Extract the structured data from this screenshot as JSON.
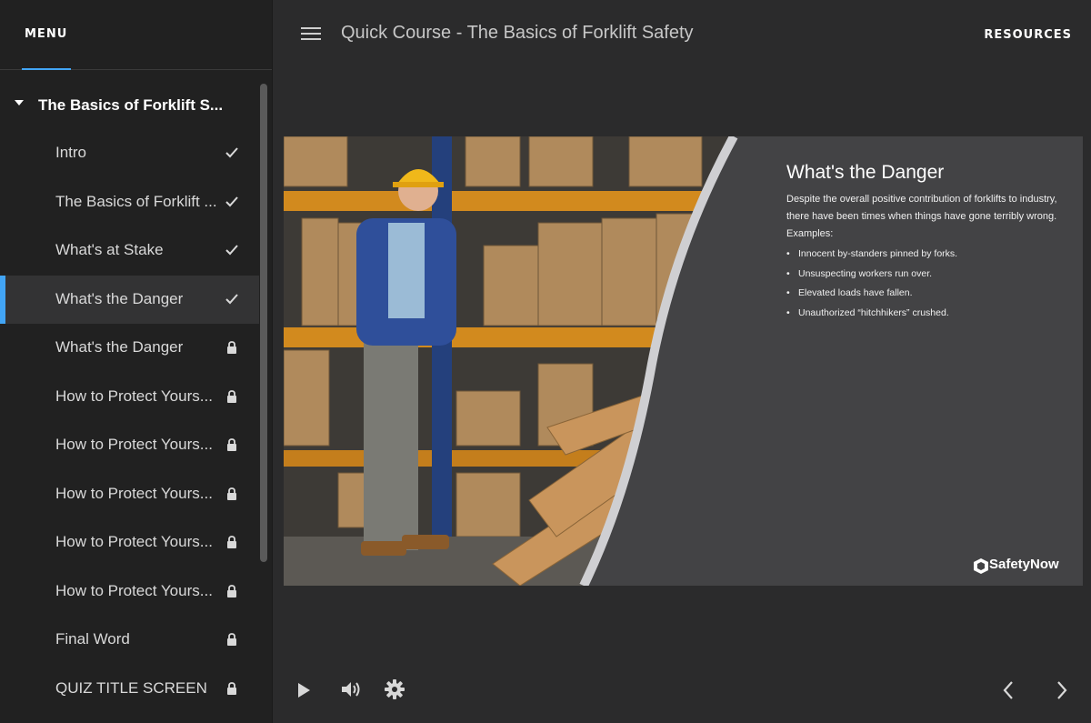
{
  "sidebar": {
    "menu_label": "MENU",
    "section_title": "The Basics of Forklift S...",
    "lessons": [
      {
        "label": "Intro",
        "status": "check-icon"
      },
      {
        "label": "The Basics of Forklift ...",
        "status": "check-icon"
      },
      {
        "label": "What's at Stake",
        "status": "check-icon"
      },
      {
        "label": "What's the Danger",
        "status": "check-icon",
        "active": true
      },
      {
        "label": "What's the Danger",
        "status": "lock-icon"
      },
      {
        "label": "How to Protect Yours...",
        "status": "lock-icon"
      },
      {
        "label": "How to Protect Yours...",
        "status": "lock-icon"
      },
      {
        "label": "How to Protect Yours...",
        "status": "lock-icon"
      },
      {
        "label": "How to Protect Yours...",
        "status": "lock-icon"
      },
      {
        "label": "How to Protect Yours...",
        "status": "lock-icon"
      },
      {
        "label": "Final Word",
        "status": "lock-icon"
      },
      {
        "label": "QUIZ TITLE SCREEN",
        "status": "lock-icon"
      }
    ]
  },
  "topbar": {
    "course_title": "Quick Course - The Basics of Forklift Safety",
    "resources_label": "RESOURCES"
  },
  "slide": {
    "title": "What's the Danger",
    "intro": "Despite the overall positive contribution of forklifts to industry, there have been times when things have gone terribly wrong.",
    "examples_label": "Examples:",
    "bullets": [
      "Innocent by-standers pinned by forks.",
      "Unsuspecting workers run over.",
      "Elevated loads have fallen.",
      "Unauthorized “hitchhikers” crushed."
    ],
    "brand": "SafetyNow"
  },
  "colors": {
    "accent": "#42a5f5",
    "sidebar_bg": "#212121",
    "main_bg": "#2b2b2c",
    "slide_panel": "#434345"
  }
}
